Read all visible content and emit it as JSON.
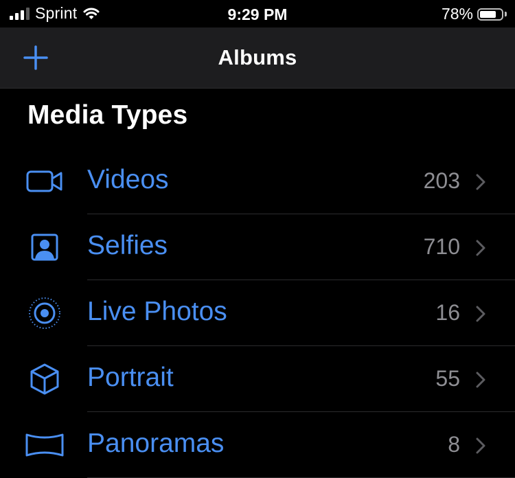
{
  "status_bar": {
    "carrier": "Sprint",
    "time": "9:29 PM",
    "battery_percent": "78%",
    "battery_level": 0.78,
    "signal_bars": 3,
    "signal_bars_total": 4
  },
  "nav": {
    "title": "Albums",
    "add_icon": "plus-icon"
  },
  "section": {
    "title": "Media Types"
  },
  "items": [
    {
      "label": "Videos",
      "count": "203",
      "icon": "video-camera-icon"
    },
    {
      "label": "Selfies",
      "count": "710",
      "icon": "person-portrait-icon"
    },
    {
      "label": "Live Photos",
      "count": "16",
      "icon": "live-photo-icon"
    },
    {
      "label": "Portrait",
      "count": "55",
      "icon": "cube-icon"
    },
    {
      "label": "Panoramas",
      "count": "8",
      "icon": "panorama-icon"
    }
  ],
  "colors": {
    "accent": "#4a8ff2",
    "secondary_text": "#8e8e93",
    "background": "#000000",
    "nav_background": "#1d1d1f"
  }
}
